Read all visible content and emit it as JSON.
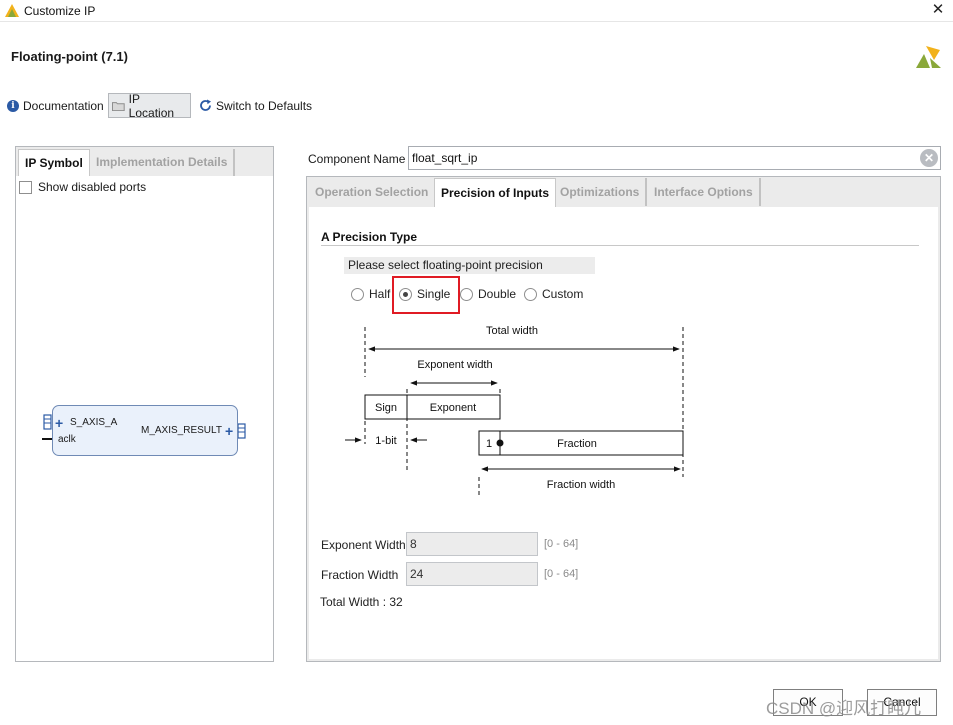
{
  "window": {
    "title": "Customize IP",
    "close_glyph": "✕"
  },
  "header": {
    "ip_title": "Floating-point (7.1)"
  },
  "toolbar": {
    "documentation": "Documentation",
    "ip_location": "IP Location",
    "switch_defaults": "Switch to Defaults"
  },
  "left": {
    "tabs": [
      "IP Symbol",
      "Implementation Details"
    ],
    "show_disabled_ports": "Show disabled ports",
    "symbol": {
      "port_in": "S_AXIS_A",
      "port_clk": "aclk",
      "port_out": "M_AXIS_RESULT"
    }
  },
  "component": {
    "label": "Component Name",
    "value": "float_sqrt_ip",
    "clear_glyph": "✕"
  },
  "tabs": [
    "Operation Selection",
    "Precision of Inputs",
    "Optimizations",
    "Interface Options"
  ],
  "precision": {
    "section_title": "A Precision Type",
    "prompt": "Please select floating-point precision",
    "options": [
      "Half",
      "Single",
      "Double",
      "Custom"
    ],
    "selected": "Single"
  },
  "diagram": {
    "total_width": "Total width",
    "exponent_width": "Exponent width",
    "sign": "Sign",
    "exponent": "Exponent",
    "one_bit": "1-bit",
    "hidden_one": "1",
    "fraction": "Fraction",
    "fraction_width": "Fraction width"
  },
  "fields": {
    "exponent_width": {
      "label": "Exponent Width",
      "value": "8",
      "range": "[0 - 64]"
    },
    "fraction_width": {
      "label": "Fraction Width",
      "value": "24",
      "range": "[0 - 64]"
    },
    "total_width": "Total Width : 32"
  },
  "footer": {
    "ok": "OK",
    "cancel": "Cancel"
  },
  "watermark": "CSDN @迎风打盹儿",
  "colors": {
    "highlight": "#e01b24",
    "accent": "#2b5aa5"
  }
}
